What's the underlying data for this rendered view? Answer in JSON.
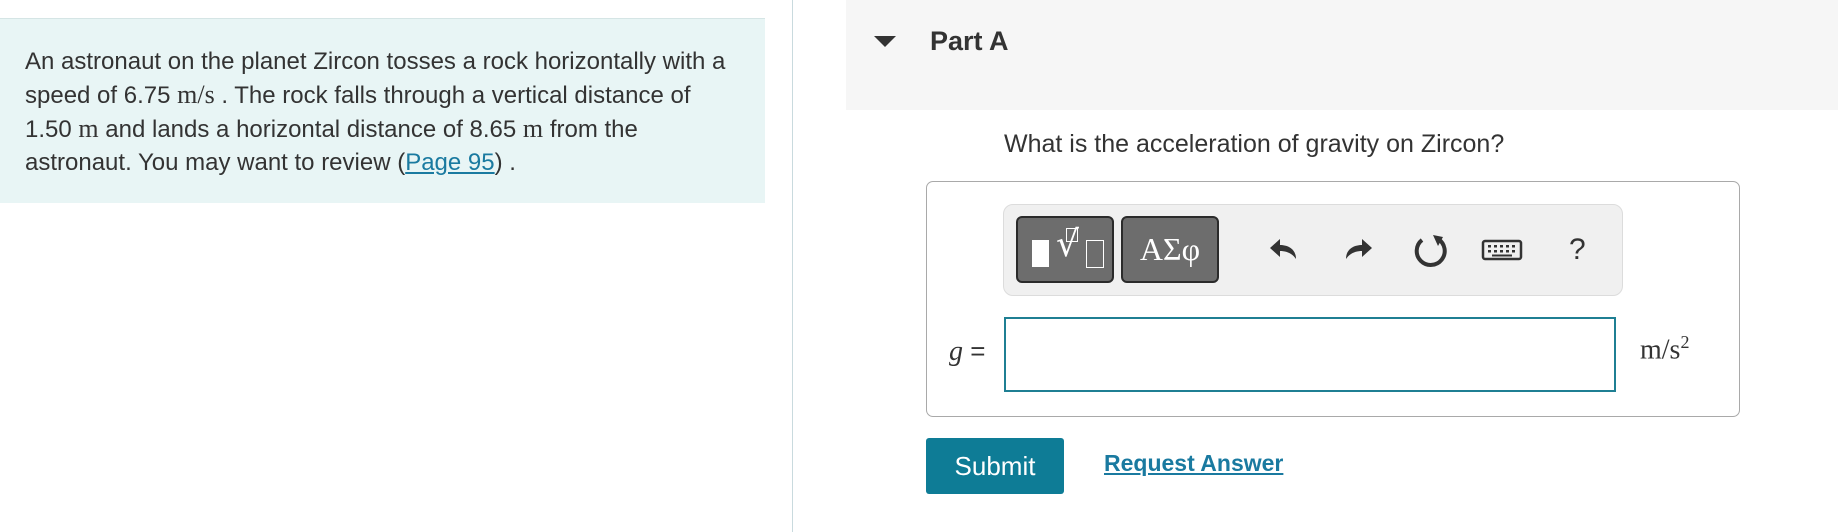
{
  "problem": {
    "text1": "An astronaut on the planet Zircon tosses a rock horizontally with a speed of 6.75 ",
    "speed_unit": "m/s",
    "text2": " . The rock falls through a vertical distance of 1.50 ",
    "dist_unit1": "m",
    "text3": " and lands a horizontal distance of 8.65 ",
    "dist_unit2": "m",
    "text4": " from the astronaut. You may want to review (",
    "link_label": "Page 95",
    "text5": ") ."
  },
  "part": {
    "title": "Part A"
  },
  "question": "What is the acceleration of gravity on Zircon?",
  "toolbar": {
    "symbols_label": "ΑΣφ",
    "help_label": "?",
    "icons": [
      "templates-icon",
      "undo-icon",
      "redo-icon",
      "reset-icon",
      "keyboard-icon"
    ]
  },
  "answer": {
    "variable": "g",
    "equals": "=",
    "value": "",
    "unit_base": "m/s",
    "unit_exp": "2"
  },
  "actions": {
    "submit_label": "Submit",
    "request_label": "Request Answer"
  },
  "colors": {
    "accent": "#0e7c96",
    "link": "#1a7aa0",
    "problem_bg": "#e8f5f5",
    "toolbar_button": "#6d6d6d"
  }
}
